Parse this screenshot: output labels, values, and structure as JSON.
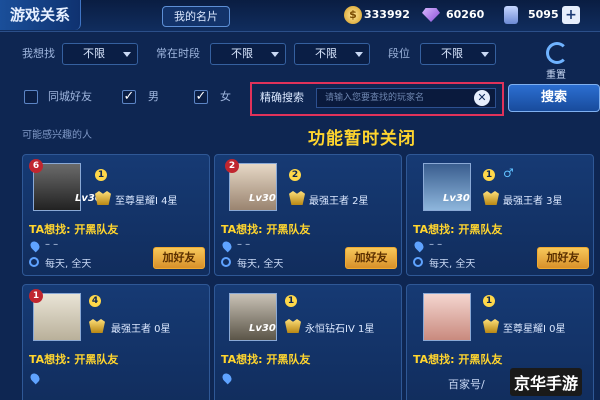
{
  "header": {
    "title": "游戏关系",
    "my_card_tab": "我的名片"
  },
  "currency": {
    "gold": "333992",
    "diamond": "60260",
    "voucher": "5095",
    "plus": "+"
  },
  "filters": {
    "want_label": "我想找",
    "want_value": "不限",
    "online_label": "常在时段",
    "online_value_1": "不限",
    "online_value_2": "不限",
    "rank_label": "段位",
    "rank_value": "不限",
    "reset_label": "重置",
    "same_city": "同城好友",
    "male": "男",
    "female": "女",
    "check_mark": "✓"
  },
  "search": {
    "label": "精确搜索",
    "placeholder": "请输入您要查找的玩家名",
    "clear": "✕",
    "button": "搜索"
  },
  "notice": "功能暂时关闭",
  "section_title": "可能感兴趣的人",
  "cards": [
    {
      "badge": "6",
      "lv": "Lv30",
      "tier": "1",
      "rank": "至尊星耀I 4星",
      "want": "TA想找: 开黑队友",
      "location": "– –",
      "time": "每天, 全天",
      "add": "加好友"
    },
    {
      "badge": "2",
      "lv": "Lv30",
      "tier": "2",
      "rank": "最强王者 2星",
      "want": "TA想找: 开黑队友",
      "location": "– –",
      "time": "每天, 全天",
      "add": "加好友"
    },
    {
      "badge": "",
      "lv": "Lv30",
      "tier": "1",
      "rank": "最强王者 3星",
      "want": "TA想找: 开黑队友",
      "location": "– –",
      "time": "每天, 全天",
      "add": "加好友",
      "gender": "♂"
    },
    {
      "badge": "1",
      "lv": "",
      "tier": "4",
      "rank": "最强王者 0星",
      "want": "TA想找: 开黑队友",
      "location": "",
      "time": "",
      "add": ""
    },
    {
      "badge": "",
      "lv": "Lv30",
      "tier": "1",
      "rank": "永恒钻石IV 1星",
      "want": "TA想找: 开黑队友",
      "location": "",
      "time": "",
      "add": ""
    },
    {
      "badge": "",
      "lv": "",
      "tier": "1",
      "rank": "至尊星耀I 0星",
      "want": "TA想找: 开黑队友",
      "location": "",
      "time": "",
      "add": ""
    }
  ],
  "footer": "百家号/",
  "watermark": "京华手游"
}
